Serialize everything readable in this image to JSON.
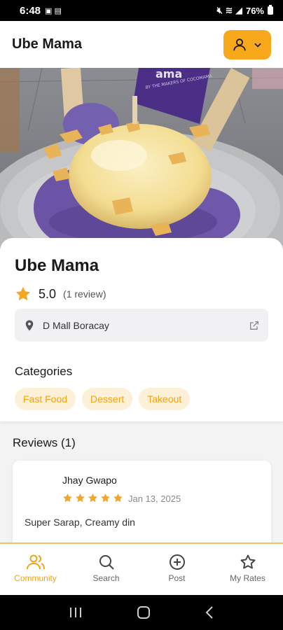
{
  "status_bar": {
    "time": "6:48",
    "battery": "76%"
  },
  "header": {
    "title": "Ube Mama"
  },
  "hero": {
    "banner_text": "ama",
    "banner_subtext": "BY THE MAKERS OF COCOMAMA"
  },
  "place": {
    "name": "Ube Mama",
    "rating": "5.0",
    "review_count": "(1 review)",
    "location": "D Mall Boracay"
  },
  "categories": {
    "title": "Categories",
    "items": [
      "Fast Food",
      "Dessert",
      "Takeout"
    ]
  },
  "reviews": {
    "title": "Reviews (1)",
    "items": [
      {
        "reviewer": "Jhay Gwapo",
        "stars": 5,
        "date": "Jan 13, 2025",
        "text": "Super Sarap, Creamy din"
      }
    ]
  },
  "nav": {
    "items": [
      {
        "label": "Community",
        "icon": "community-icon",
        "active": true
      },
      {
        "label": "Search",
        "icon": "search-icon",
        "active": false
      },
      {
        "label": "Post",
        "icon": "post-icon",
        "active": false
      },
      {
        "label": "My Rates",
        "icon": "star-icon",
        "active": false
      }
    ]
  },
  "colors": {
    "accent": "#f7a81b",
    "chip_bg": "#fdf0d8",
    "chip_text": "#f4a10e",
    "star": "#f5a623"
  }
}
